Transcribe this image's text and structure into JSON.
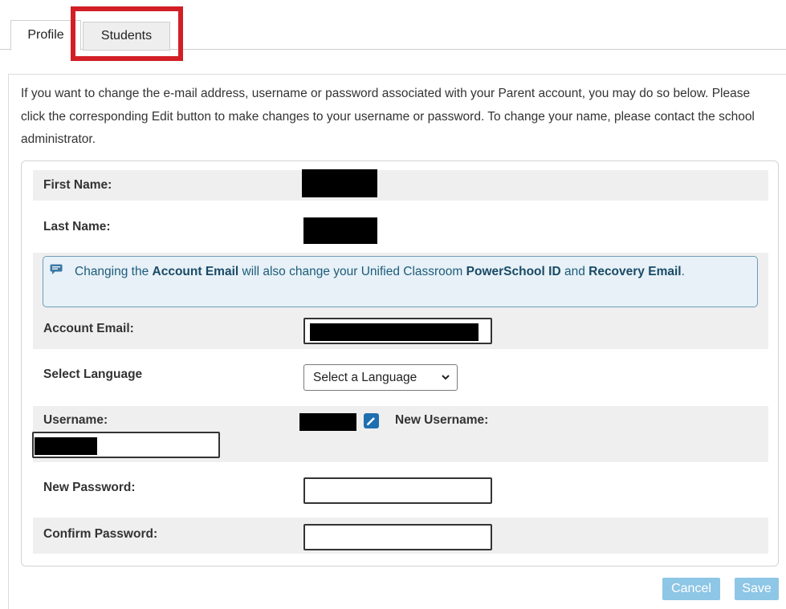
{
  "tabs": [
    {
      "label": "Profile",
      "active": true
    },
    {
      "label": "Students",
      "active": false
    }
  ],
  "intro_text": "If you want to change the e-mail address, username or password associated with your Parent account, you may do so below. Please click the corresponding Edit button to make changes to your username or password. To change your name, please contact the school administrator.",
  "form": {
    "first_name_label": "First Name:",
    "last_name_label": "Last Name:",
    "notice": {
      "prefix": "Changing the ",
      "account_email": "Account Email",
      "middle": " will also change your Unified Classroom ",
      "powerschool_id": "PowerSchool ID",
      "and": " and ",
      "recovery_email": "Recovery Email",
      "suffix": "."
    },
    "account_email_label": "Account Email:",
    "select_language_label": "Select Language",
    "language_select_value": "Select a Language",
    "username_label": "Username:",
    "new_username_label": "New Username:",
    "new_password_label": "New Password:",
    "new_password_value": "",
    "confirm_password_label": "Confirm Password:",
    "confirm_password_value": ""
  },
  "buttons": {
    "cancel_label": "Cancel",
    "save_label": "Save"
  },
  "colors": {
    "highlight": "#d21f26",
    "notice_bg": "#e7f1f7",
    "button_bg": "#8ec6e6",
    "edit_icon": "#1f6fb0"
  },
  "icons": {
    "notice_icon": "chat-bubble-icon",
    "username_edit_icon": "pencil-edit-icon",
    "select_icon": "chevron-down-icon"
  }
}
